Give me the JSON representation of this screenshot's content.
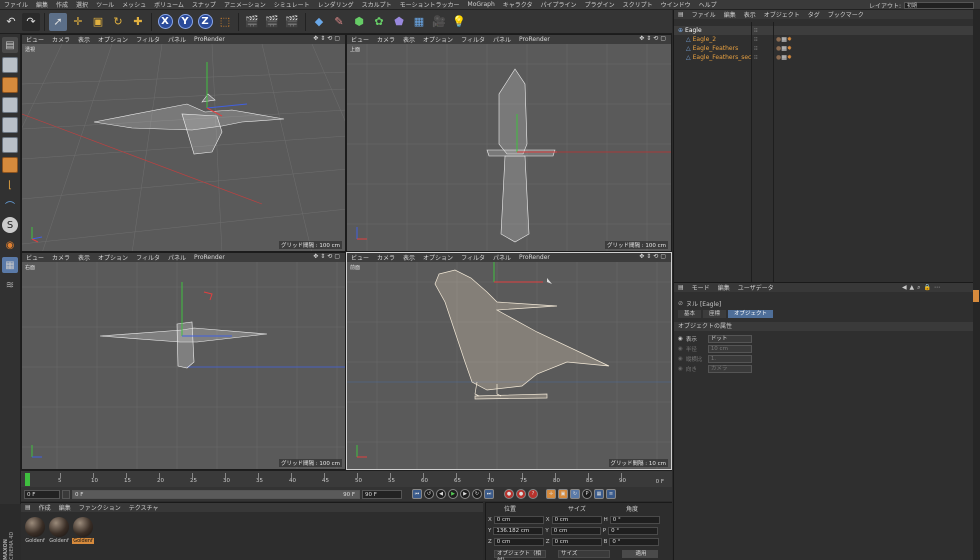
{
  "menubar": {
    "items": [
      "ファイル",
      "編集",
      "作成",
      "選択",
      "ツール",
      "メッシュ",
      "ボリューム",
      "スナップ",
      "アニメーション",
      "シミュレート",
      "レンダリング",
      "スカルプト",
      "モーショントラッカー",
      "MoGraph",
      "キャラクタ",
      "パイプライン",
      "プラグイン",
      "スクリプト",
      "ウインドウ",
      "ヘルプ"
    ],
    "layout_label": "レイアウト:",
    "layout_value": "初期"
  },
  "toolbar": {
    "axis_x": "X",
    "axis_y": "Y",
    "axis_z": "Z"
  },
  "viewports": [
    {
      "name": "透視",
      "menu": [
        "ビュー",
        "カメラ",
        "表示",
        "オプション",
        "フィルタ",
        "パネル",
        "ProRender"
      ],
      "grid": "グリッド間隔 : 100 cm",
      "active": false
    },
    {
      "name": "上面",
      "menu": [
        "ビュー",
        "カメラ",
        "表示",
        "オプション",
        "フィルタ",
        "パネル",
        "ProRender"
      ],
      "grid": "グリッド間隔 : 100 cm",
      "active": false
    },
    {
      "name": "右面",
      "menu": [
        "ビュー",
        "カメラ",
        "表示",
        "オプション",
        "フィルタ",
        "パネル",
        "ProRender"
      ],
      "grid": "グリッド間隔 : 100 cm",
      "active": false
    },
    {
      "name": "前面",
      "menu": [
        "ビュー",
        "カメラ",
        "表示",
        "オプション",
        "フィルタ",
        "パネル",
        "ProRender"
      ],
      "grid": "グリッド間隔 : 10 cm",
      "active": true
    }
  ],
  "timeline": {
    "ticks": [
      "0",
      "5",
      "10",
      "15",
      "20",
      "25",
      "30",
      "35",
      "40",
      "45",
      "50",
      "55",
      "60",
      "65",
      "70",
      "75",
      "80",
      "85",
      "90"
    ],
    "end_frame": "0 F",
    "current_frame": "0 F",
    "start_field": "0 F",
    "max_field": "90 F",
    "max_field2": "90 F"
  },
  "materials": {
    "menu": [
      "作成",
      "編集",
      "ファンクション",
      "テクスチャ"
    ],
    "items": [
      {
        "label": "Goldenf",
        "selected": false
      },
      {
        "label": "Goldenf",
        "selected": false
      },
      {
        "label": "Goldenf",
        "selected": true
      }
    ]
  },
  "coordinates": {
    "headers": [
      "位置",
      "サイズ",
      "角度"
    ],
    "rows": [
      {
        "axis": "X",
        "pos": "0 cm",
        "saxis": "X",
        "size": "0 cm",
        "raxis": "H",
        "rot": "0 °"
      },
      {
        "axis": "Y",
        "pos": "136.182 cm",
        "saxis": "Y",
        "size": "0 cm",
        "raxis": "P",
        "rot": "0 °"
      },
      {
        "axis": "Z",
        "pos": "0 cm",
        "saxis": "Z",
        "size": "0 cm",
        "raxis": "B",
        "rot": "0 °"
      }
    ],
    "mode": "オブジェクト（相対）",
    "size_mode": "サイズ",
    "apply": "適用"
  },
  "object_manager": {
    "menu": [
      "ファイル",
      "編集",
      "表示",
      "オブジェクト",
      "タグ",
      "ブックマーク"
    ],
    "objects": [
      {
        "name": "Eagle",
        "indent": 0,
        "root": true
      },
      {
        "name": "Eagle_2",
        "indent": 1,
        "root": false
      },
      {
        "name": "Eagle_Feathers",
        "indent": 1,
        "root": false
      },
      {
        "name": "Eagle_Feathers_sec",
        "indent": 1,
        "root": false
      }
    ]
  },
  "attribute_manager": {
    "menu": [
      "モード",
      "編集",
      "ユーザデータ"
    ],
    "title": "ヌル [Eagle]",
    "tabs": [
      {
        "label": "基本",
        "active": false
      },
      {
        "label": "座標",
        "active": false
      },
      {
        "label": "オブジェクト",
        "active": true
      }
    ],
    "section": "オブジェクトの属性",
    "fields": [
      {
        "label": "表示",
        "value": "ドット"
      },
      {
        "label": "半径",
        "value": "10 cm"
      },
      {
        "label": "縦横比",
        "value": "1."
      },
      {
        "label": "向き",
        "value": "カメラ"
      }
    ]
  },
  "logo": {
    "line1": "MAXON",
    "line2": "CINEMA 4D"
  },
  "colors": {
    "accent": "#d68a3c",
    "selection_blue": "#4f6f99",
    "axis_x": "#e04040",
    "axis_y": "#40c040",
    "axis_z": "#4060e0"
  }
}
